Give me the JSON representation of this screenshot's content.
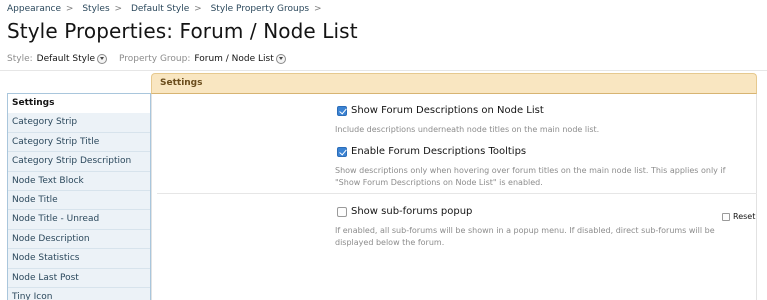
{
  "breadcrumb": [
    {
      "label": "Appearance"
    },
    {
      "label": "Styles"
    },
    {
      "label": "Default Style"
    },
    {
      "label": "Style Property Groups"
    }
  ],
  "breadcrumb_separator": ">",
  "page_title": "Style Properties: Forum / Node List",
  "filters": {
    "style_label": "Style:",
    "style_value": "Default Style",
    "group_label": "Property Group:",
    "group_value": "Forum / Node List"
  },
  "sidebar": {
    "items": [
      {
        "label": "Settings",
        "active": true
      },
      {
        "label": "Category Strip"
      },
      {
        "label": "Category Strip Title"
      },
      {
        "label": "Category Strip Description"
      },
      {
        "label": "Node Text Block"
      },
      {
        "label": "Node Title"
      },
      {
        "label": "Node Title - Unread"
      },
      {
        "label": "Node Description"
      },
      {
        "label": "Node Statistics"
      },
      {
        "label": "Node Last Post"
      },
      {
        "label": "Tiny Icon"
      }
    ]
  },
  "section": {
    "title": "Settings"
  },
  "options": [
    {
      "label": "Show Forum Descriptions on Node List",
      "checked": true,
      "description": "Include descriptions underneath node titles on the main node list."
    },
    {
      "label": "Enable Forum Descriptions Tooltips",
      "checked": true,
      "description": "Show descriptions only when hovering over forum titles on the main node list. This applies only if \"Show Forum Descriptions on Node List\" is enabled."
    },
    {
      "label": "Show sub-forums popup",
      "checked": false,
      "description": "If enabled, all sub-forums will be shown in a popup menu. If disabled, direct sub-forums will be displayed below the forum."
    }
  ],
  "reset": {
    "label": "Reset",
    "checked": false
  },
  "colors": {
    "link": "#2b485c",
    "checkbox_accent": "#3b83d3",
    "section_header_bg": "#f9e6c1",
    "sidebar_bg": "#ecf2f7"
  }
}
